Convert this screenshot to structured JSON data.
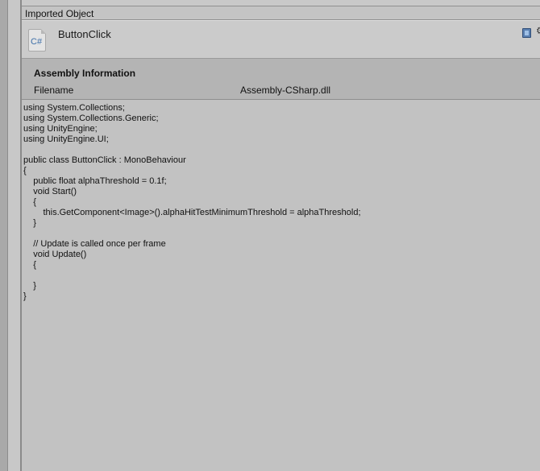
{
  "inspector": {
    "tab_title": "Imported Object",
    "asset_name": "ButtonClick",
    "file_icon_label": "C#",
    "file_icon": "csharp-script-icon",
    "help_icon": "reference-book-icon",
    "settings_icon": "gear-icon"
  },
  "assembly": {
    "title": "Assembly Information",
    "filename_label": "Filename",
    "filename_value": "Assembly-CSharp.dll"
  },
  "code": {
    "source": "using System.Collections;\nusing System.Collections.Generic;\nusing UnityEngine;\nusing UnityEngine.UI;\n\npublic class ButtonClick : MonoBehaviour\n{\n    public float alphaThreshold = 0.1f;\n    void Start()\n    {\n        this.GetComponent<Image>().alphaHitTestMinimumThreshold = alphaThreshold;\n    }\n\n    // Update is called once per frame\n    void Update()\n    {\n\n    }\n}"
  },
  "colors": {
    "panel_bg": "#c2c2c2",
    "assembly_bg": "#b4b4b4",
    "icon_accent": "#3d6fa8"
  }
}
